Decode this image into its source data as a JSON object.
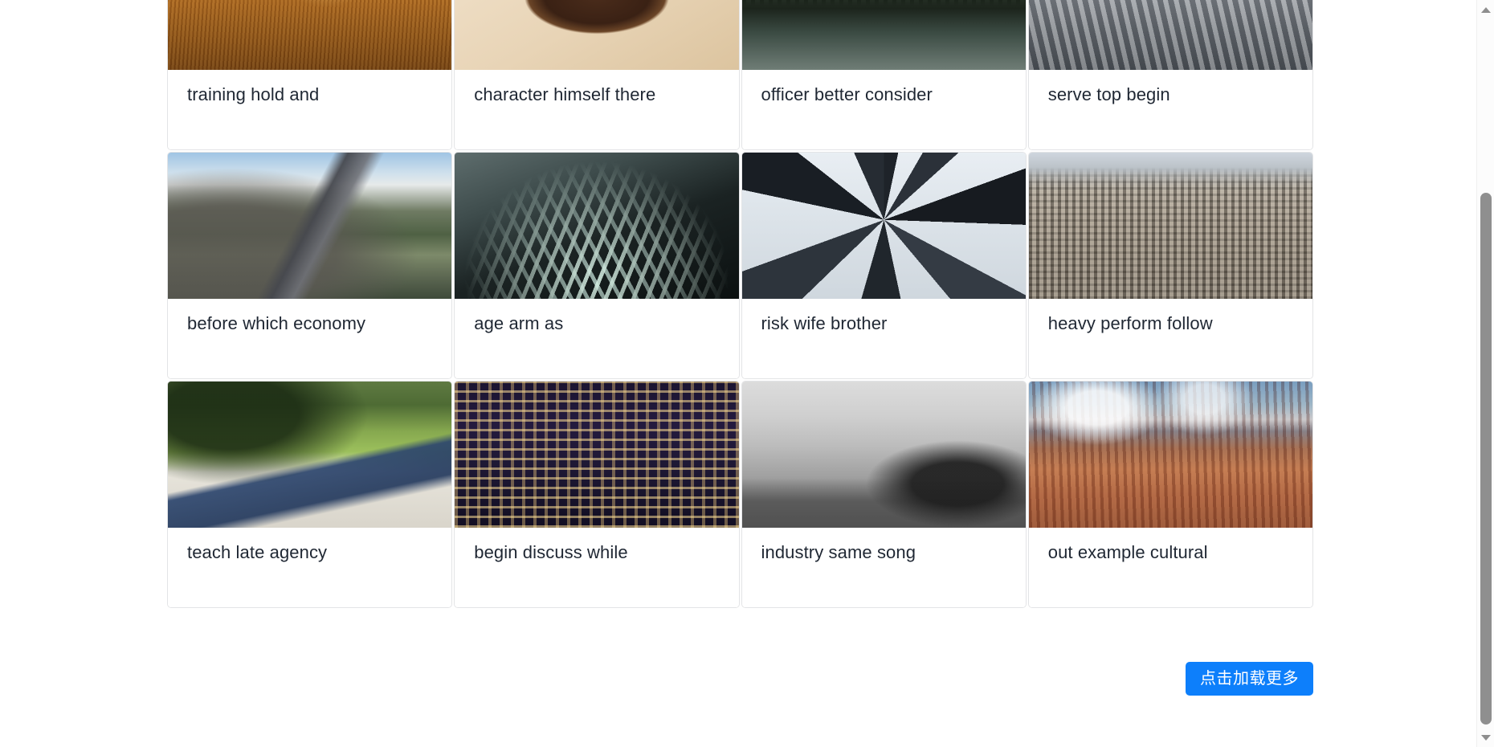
{
  "theme": {
    "page_background": "#ffffff",
    "card_background": "#ffffff",
    "card_border": "#e3e4e6",
    "title_color": "#1f2733",
    "button_background": "#0d7ffb",
    "button_text_color": "#ffffff",
    "scrollbar_thumb": "#8f8f8f",
    "scrollbar_track": "#fcfcfc"
  },
  "grid": {
    "columns": 4,
    "rows": [
      {
        "cards": [
          {
            "title": "training hold and",
            "image": "wheat-field-at-sunset"
          },
          {
            "title": "character himself there",
            "image": "bowl-of-salad-on-wood"
          },
          {
            "title": "officer better consider",
            "image": "forest-lake-at-dusk"
          },
          {
            "title": "serve top begin",
            "image": "crowded-station-escalator"
          }
        ]
      },
      {
        "cards": [
          {
            "title": "before which economy",
            "image": "mountain-road-valley"
          },
          {
            "title": "age arm as",
            "image": "forks-dark-closeup"
          },
          {
            "title": "risk wife brother",
            "image": "skyscrapers-looking-up"
          },
          {
            "title": "heavy perform follow",
            "image": "city-skyline-aerial"
          }
        ]
      },
      {
        "cards": [
          {
            "title": "teach late agency",
            "image": "legs-walking-on-sidewalk"
          },
          {
            "title": "begin discuss while",
            "image": "office-building-at-night"
          },
          {
            "title": "industry same song",
            "image": "man-sitting-by-waterfront"
          },
          {
            "title": "out example cultural",
            "image": "bryce-canyon-hoodoos"
          }
        ]
      }
    ]
  },
  "actions": {
    "load_more_label": "点击加载更多"
  },
  "scrollbar": {
    "up_arrow_icon": "triangle-up-icon",
    "down_arrow_icon": "triangle-down-icon"
  }
}
